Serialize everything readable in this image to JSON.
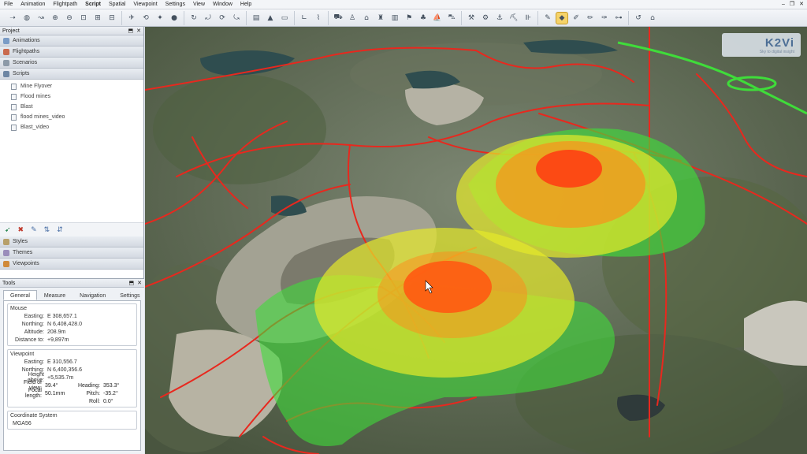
{
  "menu": [
    "File",
    "Animation",
    "Flightpath",
    "Script",
    "Spatial",
    "Viewpoint",
    "Settings",
    "View",
    "Window",
    "Help"
  ],
  "active_menu": "Script",
  "project_panel": {
    "title": "Project",
    "sections": {
      "animations": "Animations",
      "flightpaths": "Flightpaths",
      "scenarios": "Scenarios",
      "scripts": "Scripts",
      "styles": "Styles",
      "themes": "Themes",
      "viewpoints": "Viewpoints"
    },
    "scripts": [
      "Mine Flyover",
      "Flood mines",
      "Blast",
      "flood mines_video",
      "Blast_video"
    ]
  },
  "tools_panel": {
    "title": "Tools",
    "tabs": [
      "General",
      "Measure",
      "Navigation",
      "Settings"
    ],
    "active_tab": "General",
    "mouse": {
      "title": "Mouse",
      "easting_label": "Easting:",
      "easting": "E 308,657.1",
      "northing_label": "Northing:",
      "northing": "N 6,408,428.0",
      "altitude_label": "Altitude:",
      "altitude": "208.9m",
      "distance_label": "Distance to:",
      "distance": "+9,897m"
    },
    "viewpoint": {
      "title": "Viewpoint",
      "easting_label": "Easting:",
      "easting": "E 310,556.7",
      "northing_label": "Northing:",
      "northing": "N 6,400,356.6",
      "height_label": "Height above:",
      "height": "+5,535.7m",
      "fov_label": "Field of view:",
      "fov": "39.4°",
      "heading_label": "Heading:",
      "heading": "353.3°",
      "focal_label": "Focal length:",
      "focal": "50.1mm",
      "pitch_label": "Pitch:",
      "pitch": "-35.2°",
      "roll_label": "Roll:",
      "roll": "0.0°"
    },
    "coordinate_system": {
      "title": "Coordinate System",
      "value": "MGA56"
    }
  },
  "brand": {
    "name": "K2Vi",
    "tagline": "Sky to digital insight"
  },
  "colors": {
    "accent_highlight": "#f5d36a",
    "route_red": "#e8281e",
    "zone_green": "#3fdc3a",
    "zone_yellow": "#e6e92a",
    "zone_orange": "#ff8a1a",
    "zone_core": "#ff3a12"
  }
}
